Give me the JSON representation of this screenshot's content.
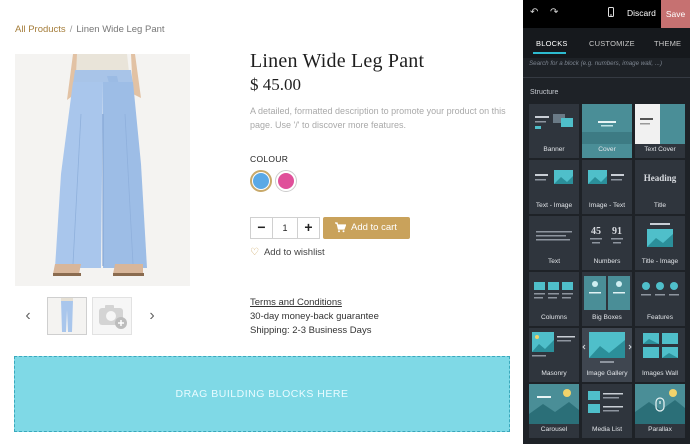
{
  "breadcrumb": {
    "link": "All Products",
    "separator": "/",
    "current": "Linen Wide Leg Pant"
  },
  "product": {
    "title": "Linen Wide Leg Pant",
    "price": "$ 45.00",
    "description": "A detailed, formatted description to promote your product on this page. Use '/' to discover more features.",
    "colour_label": "COLOUR",
    "colours": [
      "#5aa9e6",
      "#e0509a"
    ],
    "quantity": "1",
    "add_to_cart": "Add to cart",
    "wishlist": "Add to wishlist",
    "terms": "Terms and Conditions",
    "guarantee": "30-day money-back guarantee",
    "shipping": "Shipping: 2-3 Business Days"
  },
  "dropzone": {
    "text": "DRAG BUILDING BLOCKS HERE"
  },
  "editor": {
    "discard": "Discard",
    "save": "Save",
    "tabs": [
      "BLOCKS",
      "CUSTOMIZE",
      "THEME"
    ],
    "search_placeholder": "Search for a block (e.g. numbers, image wall, ...)",
    "section": "Structure",
    "blocks": [
      "Banner",
      "Cover",
      "Text Cover",
      "Text - Image",
      "Image - Text",
      "Title",
      "Text",
      "Numbers",
      "Title - Image",
      "Columns",
      "Big Boxes",
      "Features",
      "Masonry",
      "Image Gallery",
      "Images Wall",
      "Carousel",
      "Media List",
      "Parallax"
    ],
    "thumb_texts": {
      "heading": "Heading",
      "num1": "45",
      "num2": "91"
    }
  },
  "colors": {
    "accent_gold": "#c9a25b",
    "save_red": "#c67171",
    "tab_cyan": "#2dbbd0",
    "dropzone": "#7fd9e6"
  }
}
